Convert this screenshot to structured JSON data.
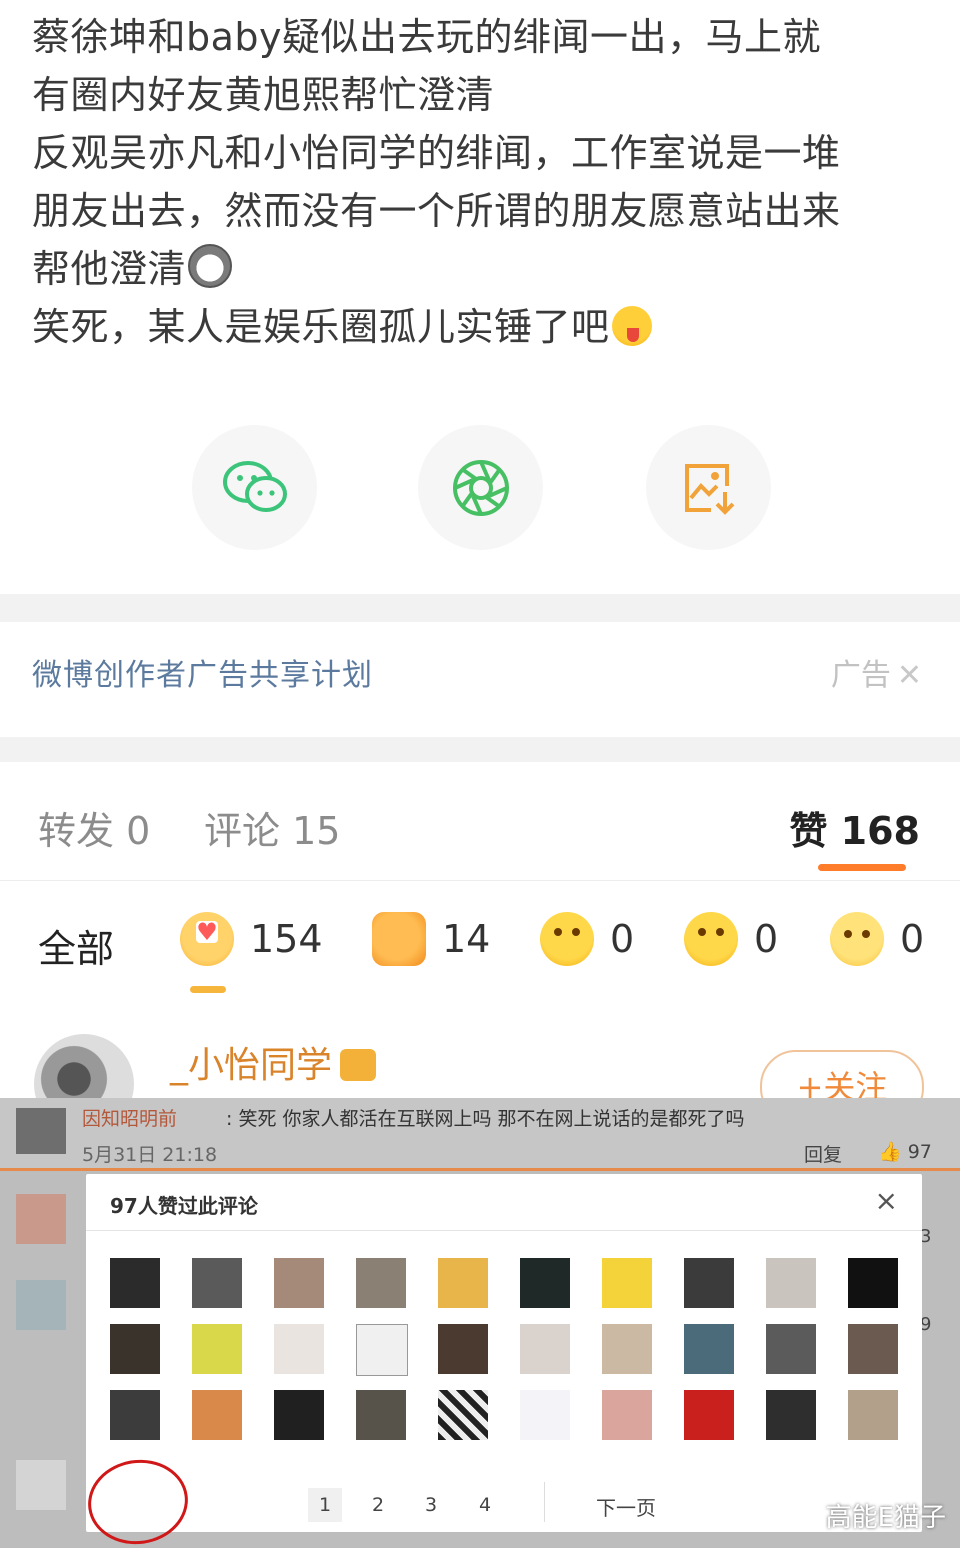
{
  "post": {
    "lines": [
      "蔡徐坤和baby疑似出去玩的绯闻一出，马上就",
      "有圈内好友黄旭熙帮忙澄清",
      "反观吴亦凡和小怡同学的绯闻，工作室说是一堆",
      "朋友出去，然而没有一个所谓的朋友愿意站出来",
      "帮他澄清",
      "笑死，某人是娱乐圈孤儿实锤了吧"
    ]
  },
  "share": [
    "wechat-icon",
    "moments-icon",
    "save-image-icon"
  ],
  "ad": {
    "title": "微博创作者广告共享计划",
    "tag": "广告"
  },
  "tabs": {
    "repost": "转发 0",
    "comment": "评论 15",
    "like": "赞 168"
  },
  "reactions": {
    "all": "全部",
    "items": [
      {
        "icon": "heart-face-icon",
        "count": "154"
      },
      {
        "icon": "thumbs-up-icon",
        "count": "14"
      },
      {
        "icon": "laugh-face-icon",
        "count": "0"
      },
      {
        "icon": "surprised-face-icon",
        "count": "0"
      },
      {
        "icon": "sad-face-icon",
        "count": "0"
      }
    ]
  },
  "commenter": {
    "name": "_小怡同学",
    "follow": "+关注"
  },
  "screenshot": {
    "comment_user": "因知昭明前",
    "comment_text": ": 笑死 你家人都活在互联网上吗 那不在网上说话的是都死了吗",
    "time": "5月31日 21:18",
    "reply": "回复",
    "likes": "97",
    "side_numbers": [
      "3",
      "9"
    ],
    "modal": {
      "title": "97人赞过此评论",
      "close": "×",
      "pages": [
        "1",
        "2",
        "3",
        "4"
      ],
      "next": "下一页"
    },
    "watermark": "高能E猫子"
  },
  "colors": {
    "accent": "#ff7c2a",
    "link": "#5b7a9e",
    "username": "#d9832a"
  }
}
